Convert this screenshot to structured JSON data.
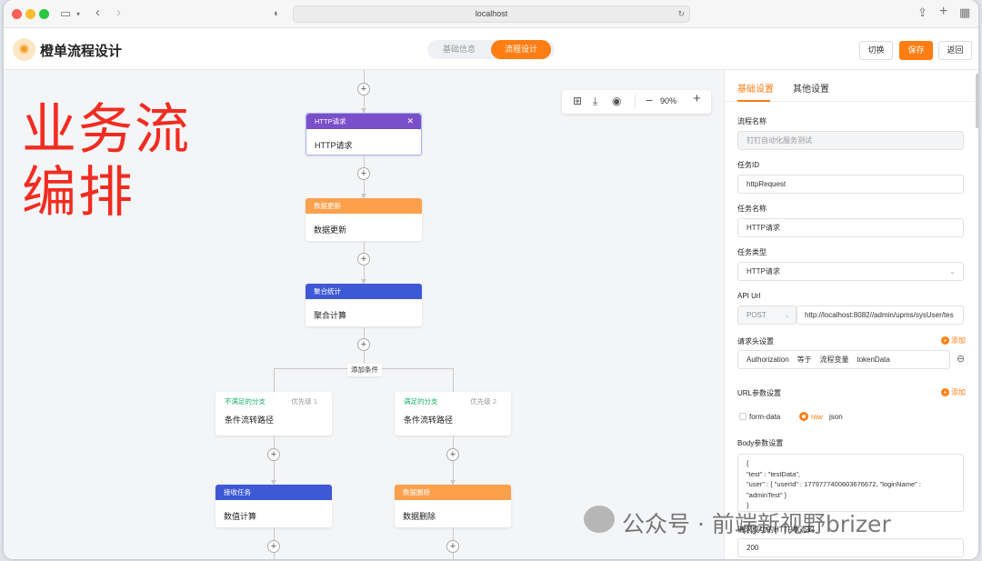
{
  "browser": {
    "url": "localhost"
  },
  "header": {
    "title": "橙单流程设计",
    "tabs": [
      "基础信息",
      "流程设计"
    ],
    "buttons": {
      "switch": "切换",
      "save": "保存",
      "back": "返回"
    }
  },
  "overlay_text": {
    "line1": "业务流",
    "line2": "编排"
  },
  "toolbar": {
    "zoom": "90%"
  },
  "flow": {
    "nodes": [
      {
        "header": "HTTP请求",
        "body": "HTTP请求",
        "color": "#7b4fc9"
      },
      {
        "header": "数据更新",
        "body": "数据更新",
        "color": "#fca04c"
      },
      {
        "header": "聚合统计",
        "body": "聚合计算",
        "color": "#3e59d6"
      }
    ],
    "condition_label": "添加条件",
    "branches": [
      {
        "title": "不满足的分支",
        "priority": "优先级 1",
        "body": "条件流转路径",
        "child_header": "接收任务",
        "child_body": "数值计算",
        "child_color": "#3e59d6"
      },
      {
        "title": "满足的分支",
        "priority": "优先级 2",
        "body": "条件流转路径",
        "child_header": "数据删除",
        "child_body": "数据删除",
        "child_color": "#fca04c"
      }
    ]
  },
  "panel": {
    "tabs": [
      "基础设置",
      "其他设置"
    ],
    "flow_name_label": "流程名称",
    "flow_name_value": "钉钉自动化服务测试",
    "task_id_label": "任务ID",
    "task_id_value": "httpRequest",
    "task_name_label": "任务名称",
    "task_name_value": "HTTP请求",
    "task_type_label": "任务类型",
    "task_type_value": "HTTP请求",
    "api_url_label": "API Url",
    "api_method": "POST",
    "api_url_value": "http://localhost:8082//admin/upms/sysUser/tes",
    "headers_label": "请求头设置",
    "add_label": "添加",
    "header_row": "Authorization    等于    流程变量    tokenData",
    "url_params_label": "URL参数设置",
    "radio_formdata": "form-data",
    "radio_raw": "raw",
    "raw_format": "json",
    "body_label": "Body参数设置",
    "body_lines": [
      "{",
      "\"test\" : \"testData\",",
      "\"user\" : { \"userId\" : 1779777400603676672, \"loginName\" :",
      "\"adminTest\" }",
      "}"
    ],
    "status_label": "请求成功的HTTP状态码",
    "status_value": "200"
  },
  "watermark": "公众号 · 前端新视野brizer"
}
